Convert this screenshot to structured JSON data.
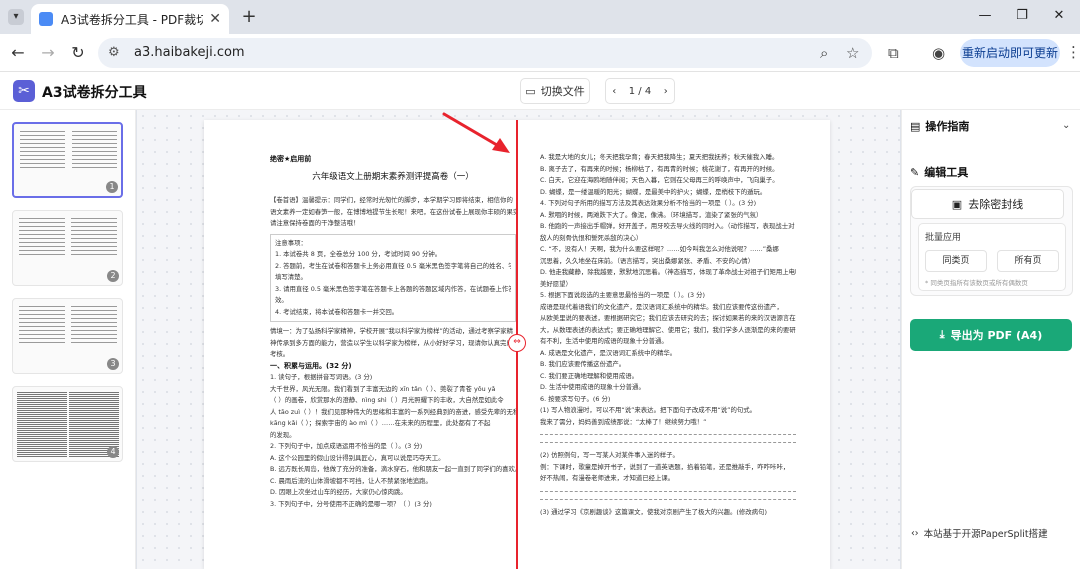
{
  "browser": {
    "tab_title": "A3试卷拆分工具 - PDF裁切、",
    "new_tab": "+",
    "url": "a3.haibakeji.com",
    "update_button": "重新启动即可更新",
    "icons": [
      "back-icon",
      "forward-icon",
      "reload-icon",
      "site-info-icon",
      "zoom-icon",
      "star-icon",
      "extensions-icon",
      "profile-icon",
      "menu-icon"
    ]
  },
  "app": {
    "title": "A3试卷拆分工具",
    "switch_file": "切换文件",
    "page_indicator": "1 / 4"
  },
  "thumbnails": [
    {
      "num": "1",
      "active": true
    },
    {
      "num": "2",
      "active": false
    },
    {
      "num": "3",
      "active": false
    },
    {
      "num": "4",
      "active": false
    }
  ],
  "document": {
    "secret_label": "绝密★启用前",
    "exam_title": "六年级语文上册期末素养测评提高卷（一）",
    "left_lines": [
      "【卷首语】温馨提示：同学们，经常时光匆忙的脚步，本学期学习即将结束，相信你的",
      "语文素养一定如春笋一般，在博博地提节生长呢！来吧，在这份试卷上展现你丰硕的果实吧！",
      "请注意保持卷面的干净整洁哦！"
    ],
    "notice_title": "注意事项：",
    "notice_lines": [
      "1. 本试卷共 8 页，全卷总分 100 分，考试时间 90 分钟。",
      "2. 答题前，考生在试卷和答题卡上务必用直径 0.5 毫米黑色签字笔将自己的姓名、学号",
      "填写清楚。",
      "3. 请用直径 0.5 毫米黑色签字笔在答题卡上各题的答题区域内作答，在试题卷上作答无",
      "效。",
      "4. 考试结束，将本试卷和答题卡一并交回。"
    ],
    "left_lines2": [
      "情境一：为了弘扬科学家精神，学校开展“我以科学家为榜样”的活动，通过考察学家精",
      "神传承到多方面的能力，营造以学生以科学家为榜样，从小好好学习，现请你认真完成此",
      "考核。"
    ],
    "section_one": "一、积累与运用。(32 分)",
    "left_lines3": [
      "1. 读句子，根据拼音写词语。(3 分)",
      "大千世界，风光无限。我们看到了丰富无边的 xīn     tǎn（     ）、莞裂了青苍 yǒu   yǎ",
      "（     ）的画卷，欣赏那水的澄静、nìng   shì（     ）月光照耀下的丰收，大自然是如此令",
      "人 tāo   zuì（     ）！我们见那种伟大的思绪和丰富的一系列经典到的奋进，感受先辈的无私与",
      "kāng   kǎi（     ）；探索宇宙的 ào   mì（     ）……在未来的历程里，此处都有了不起",
      "的发现。",
      "2. 下列句子中，加点成语运用不恰当的是（     ）。(3 分)",
      "A. 这个公园里的假山设计得别具匠心，真可以说是巧夺天工。",
      "B. 远方既长周岛，他做了充分的准备，滴水穿石，他和朋友一起一直到了同学们的喜欢。",
      "C. 晨雨后流的山体滑坡都不可挡，让人不禁紧张地追跑。",
      "D. 因眼上次坐过山车的经历，大家仍心惊肉跳。",
      "3. 下列句子中，分号使用不正确的是哪一项？（     ）(3 分)"
    ],
    "right_lines": [
      "A. 我是大地的女儿；冬天把我孕育；春天把我降生；夏天把我抚养；秋天催我入睡。",
      "B. 离子去了，有再来的时候；杨柳枯了，有再青的时候；桃花谢了，有再开的时候。",
      "C. 白天，它迎在海鸥地随伴阅；天色入暮，它则在父母再三的呼唤声中，飞向巢子。",
      "D. 蝴蝶，是一缕温暖的阳光；蝴蝶，是最美中的护火；蝴蝶，是梢枝下的遁玩。",
      "4. 下列对句子所用的描写方法及其表达效果分析不恰当的一项是（     ）。(3 分)",
      "A. 默咽的时候，两滩跌下大了。像泥，像沸。（环境描写，渲染了紧张的气氛）",
      "B. 他跑的一声接出手帽弹，好开盖子，用牙咬去导火线的同时入。（动作描写，表现战士对",
      "敌人的刻骨仇恨和誓死杀敌的决心）",
      "C. “不，没有人！天啊，我为什么要这样呢？……如今叫我怎么对他说呢？……”桑娜",
      "沉思着，久久地坐在床前。（语言描写，突出桑娜紧张、矛盾、不安的心情）",
      "D. 他走我藏静，除我越要，默默地沉思着。（神态描写，体现了革命战士对祖子们矩用上电叮的",
      "美好愿望）",
      "5. 根据下面说段选的主要意思最恰当的一项是（     ）。(3 分)",
      "     成语是现代着语我们的文化遗产，是汉语词汇系统中的精华。我们应该要传这份遗产，",
      "从欧美里说的要表述，要根据研究它；我们应该去研究的去；探讨如果若的来的汉语源言在这研究",
      "大，从数理表述的表达式；要正确地理解它、使用它；我们，我们学多人逐渐是的来的要研究",
      "有不利，生活中使用的成语的现象十分普通。",
      "A. 成语是文化遗产，是汉语词汇系统中的精华。",
      "B. 我们应该要传播这份遗产。",
      "C. 我们要正确地理解和使用成语。",
      "D. 生活中使用成语的现象十分普通。",
      "6. 按要求写句子。(6 分)",
      "(1) 写人物浪漫时，可以不用“说”来表达。把下面句子改成不用“说”的句式。",
      "我来了需分，妈妈善到成绩那说：“太棒了！继续努力哦！”"
    ],
    "right_lines2": [
      "(2) 仿照例句，写一写某人对某件事入迷的样子。",
      "例：下课时，歌童是掉开书子，说到了一道英语题，掐着铅笔，还是推敲手，咋咋咔咔，",
      "好不热闹，有漫卷老师进来，才知道已经上课。"
    ],
    "right_lines3": [
      "(3) 通过学习《京剧趣谈》这篇课文，使我对京剧产生了极大的兴趣。(修改病句)"
    ]
  },
  "panel": {
    "guide_title": "操作指南",
    "tools_title": "编辑工具",
    "remove_seal": "去除密封线",
    "batch_label": "批量应用",
    "same_type": "同类页",
    "all_pages": "所有页",
    "batch_hint": "* 同类页指所有该数页或所有偶数页",
    "export": "导出为 PDF (A4)",
    "footer": "本站基于开源PaperSplit搭建"
  },
  "colors": {
    "accent": "#5b5fd6",
    "split_line": "#e8232d",
    "export_bg": "#1aa878",
    "update_bg": "#d3e3fd"
  }
}
